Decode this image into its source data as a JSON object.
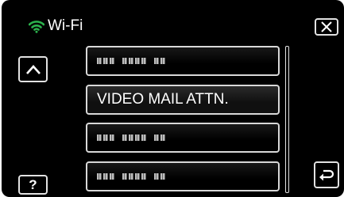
{
  "header": {
    "title": "Wi-Fi",
    "wifi_icon": "wifi-icon",
    "wifi_color": "#2bb24c"
  },
  "buttons": {
    "close_icon": "close-icon",
    "scroll_up_icon": "chevron-up-icon",
    "help_label": "?",
    "back_icon": "return-icon"
  },
  "list": {
    "items": [
      {
        "label": "",
        "masked": true
      },
      {
        "label": "VIDEO MAIL ATTN.",
        "masked": false
      },
      {
        "label": "",
        "masked": true
      },
      {
        "label": "",
        "masked": true
      }
    ]
  }
}
